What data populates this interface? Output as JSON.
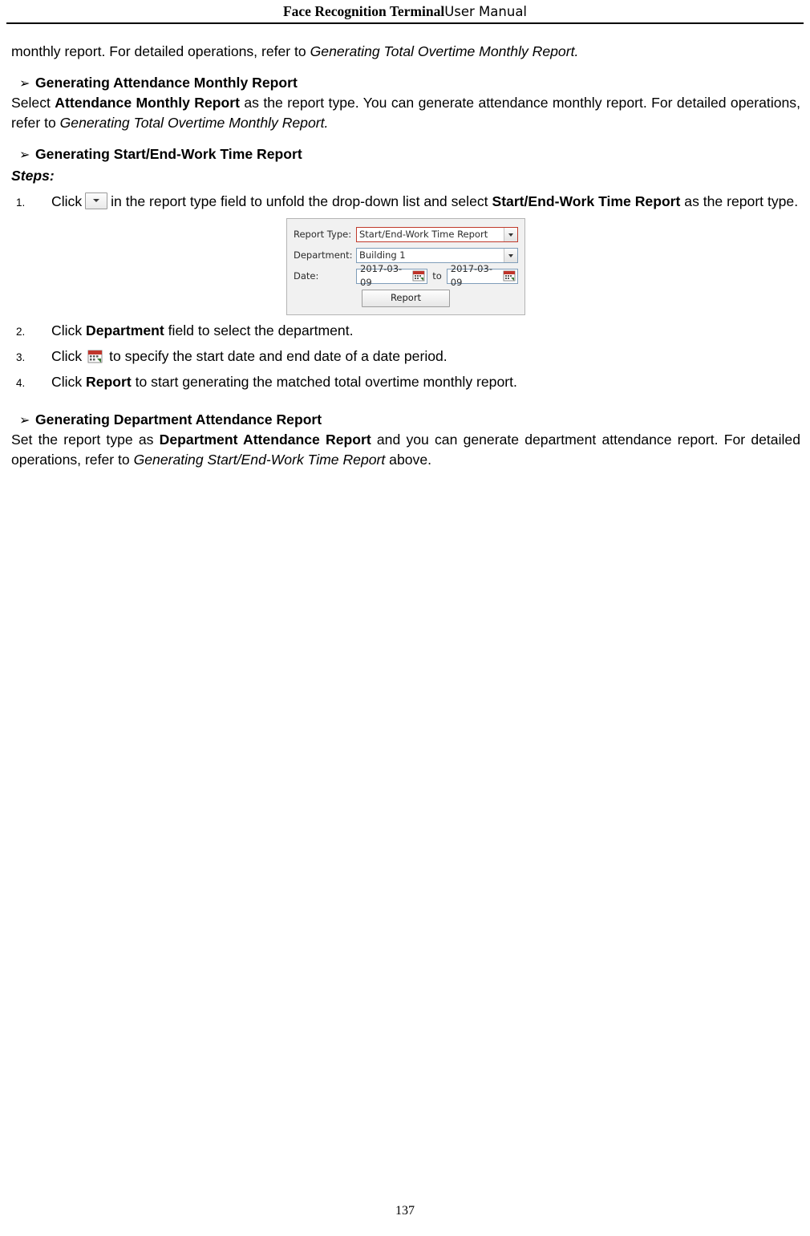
{
  "header": {
    "title_bold": "Face Recognition Terminal",
    "title_rest": "User Manual"
  },
  "body": {
    "intro_text_1": "monthly report. For detailed operations, refer to ",
    "intro_italic_1": "Generating Total Overtime Monthly Report.",
    "section1": {
      "arrow": "➢",
      "heading": "Generating Attendance Monthly Report",
      "p_part1": "Select ",
      "p_bold1": "Attendance Monthly Report",
      "p_part2": " as the report type. You can generate attendance monthly report. For detailed operations, refer to ",
      "p_italic1": "Generating Total Overtime Monthly Report."
    },
    "section2": {
      "arrow": "➢",
      "heading": "Generating Start/End-Work Time Report",
      "steps_label": "Steps:",
      "steps": [
        {
          "num": "1.",
          "pre": "Click",
          "icon": "dropdown-arrow-icon",
          "mid": "in the report type field to unfold the drop-down list and select ",
          "bold": "Start/End-Work Time Report",
          "post": " as the report type."
        },
        {
          "num": "2.",
          "pre": "Click ",
          "bold": "Department",
          "post": " field to select the department."
        },
        {
          "num": "3.",
          "pre": "Click",
          "icon": "calendar-icon",
          "post": "to specify the start date and end date of a date period."
        },
        {
          "num": "4.",
          "pre": "Click ",
          "bold": "Report",
          "post": " to start generating the matched total overtime monthly report."
        }
      ]
    },
    "section3": {
      "arrow": "➢",
      "heading": "Generating Department Attendance Report",
      "p_part1": "Set the report type as ",
      "p_bold1": "Department Attendance Report",
      "p_part2": " and you can generate department attendance report. For detailed operations, refer to ",
      "p_italic1": "Generating Start/End-Work Time Report",
      "p_part3": " above."
    }
  },
  "dialog": {
    "report_type_label": "Report Type:",
    "report_type_value": "Start/End-Work Time Report",
    "department_label": "Department:",
    "department_value": "Building 1",
    "date_label": "Date:",
    "date_start": "2017-03-09",
    "date_to": "to",
    "date_end": "2017-03-09",
    "report_button": "Report"
  },
  "footer": {
    "page_number": "137"
  }
}
